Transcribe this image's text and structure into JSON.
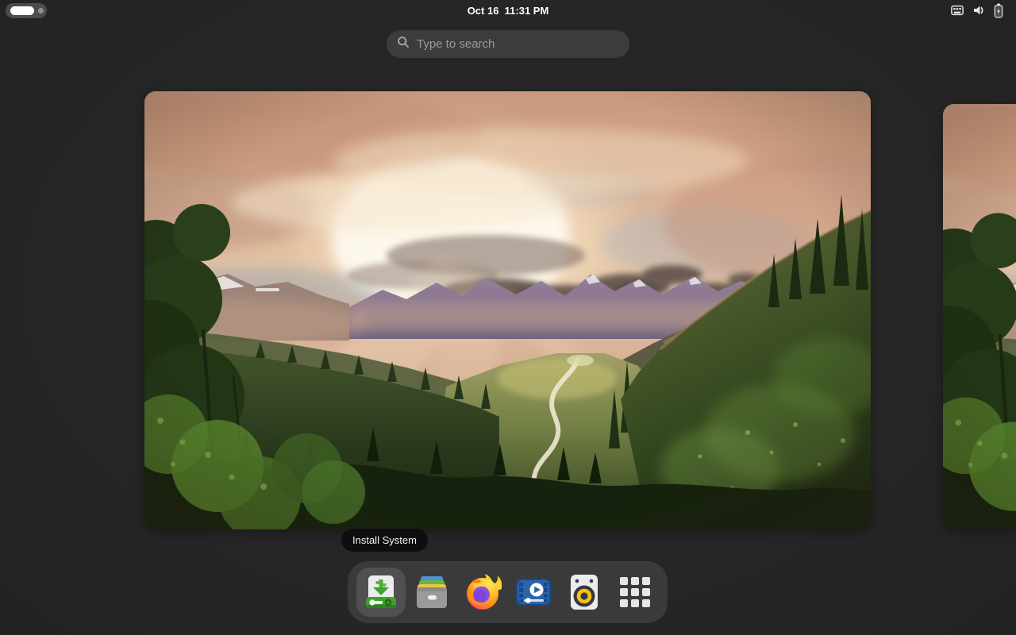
{
  "topbar": {
    "clock": "Oct 16  11:31 PM",
    "workspace_indicator": {
      "total": 2,
      "active": 1
    },
    "status_icons": [
      "keyboard-icon",
      "volume-icon",
      "battery-charging-icon"
    ]
  },
  "search": {
    "placeholder": "Type to search",
    "value": ""
  },
  "overview": {
    "workspace_count": 2,
    "wallpaper": "mountain-valley-sunset"
  },
  "tooltip": {
    "label": "Install System"
  },
  "dock": {
    "items": [
      {
        "name": "installer",
        "icon": "installer-icon",
        "hovered": true
      },
      {
        "name": "files",
        "icon": "file-cabinet-icon",
        "hovered": false
      },
      {
        "name": "firefox",
        "icon": "firefox-icon",
        "hovered": false
      },
      {
        "name": "videos",
        "icon": "video-player-icon",
        "hovered": false
      },
      {
        "name": "audio-player",
        "icon": "speaker-icon",
        "hovered": false
      },
      {
        "name": "app-grid",
        "icon": "app-grid-icon",
        "hovered": false
      }
    ]
  },
  "colors": {
    "background": "#262626",
    "dock_bg": "#3a3a3a",
    "dock_hover": "#505050",
    "tooltip_bg": "#0e0e0e",
    "search_bg": "#3c3c3c",
    "muted_text": "#9b9b9b",
    "clock_text": "#ffffff"
  }
}
